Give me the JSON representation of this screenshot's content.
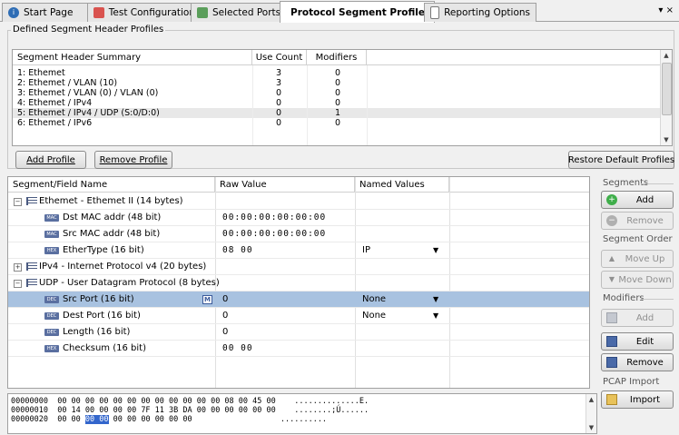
{
  "tabs": [
    {
      "label": "Start Page",
      "icon": "info-icon"
    },
    {
      "label": "Test Configuration",
      "icon": "test-config-icon"
    },
    {
      "label": "Selected Ports",
      "icon": "ports-icon"
    },
    {
      "label": "Protocol Segment Profiles",
      "icon": "profiles-icon",
      "active": true
    },
    {
      "label": "Reporting Options",
      "icon": "report-icon"
    }
  ],
  "tab_overflow_glyph": "▾ ×",
  "profiles": {
    "group_label": "Defined Segment Header Profiles",
    "columns": [
      "Segment Header Summary",
      "Use Count",
      "Modifiers"
    ],
    "rows": [
      {
        "summary": "1: Ethemet",
        "use_count": "3",
        "modifiers": "0"
      },
      {
        "summary": "2: Ethemet / VLAN (10)",
        "use_count": "3",
        "modifiers": "0"
      },
      {
        "summary": "3: Ethemet / VLAN (0) / VLAN (0)",
        "use_count": "0",
        "modifiers": "0"
      },
      {
        "summary": "4: Ethemet / IPv4",
        "use_count": "0",
        "modifiers": "0"
      },
      {
        "summary": "5: Ethemet / IPv4 / UDP (S:0/D:0)",
        "use_count": "0",
        "modifiers": "1"
      },
      {
        "summary": "6: Ethemet / IPv6",
        "use_count": "0",
        "modifiers": "0"
      }
    ],
    "add_button": "Add Profile",
    "remove_button": "Remove Profile",
    "restore_button": "Restore Default Profiles"
  },
  "fields": {
    "columns": [
      "Segment/Field Name",
      "Raw Value",
      "Named Values"
    ],
    "rows": [
      {
        "name": "Ethemet - Ethemet II (14 bytes)",
        "raw": "",
        "named": "",
        "level": 0,
        "expander": "−",
        "kind": "segment"
      },
      {
        "name": "Dst MAC addr (48 bit)",
        "raw": "00:00:00:00:00:00",
        "named": "",
        "level": 1,
        "badge": "MAC",
        "kind": "field"
      },
      {
        "name": "Src MAC addr (48 bit)",
        "raw": "00:00:00:00:00:00",
        "named": "",
        "level": 1,
        "badge": "MAC",
        "kind": "field"
      },
      {
        "name": "EtherType (16 bit)",
        "raw": "08 00",
        "named": "IP",
        "level": 1,
        "badge": "HEX",
        "kind": "field",
        "dropdown": true
      },
      {
        "name": "IPv4 - Internet Protocol v4 (20 bytes)",
        "raw": "",
        "named": "",
        "level": 0,
        "expander": "+",
        "kind": "segment"
      },
      {
        "name": "UDP - User Datagram Protocol (8 bytes)",
        "raw": "",
        "named": "",
        "level": 0,
        "expander": "−",
        "kind": "segment"
      },
      {
        "name": "Src Port (16 bit)",
        "raw": "0",
        "named": "None",
        "level": 1,
        "badge": "DEC",
        "kind": "field",
        "dropdown": true,
        "selected": true,
        "modifier_mark": "M"
      },
      {
        "name": "Dest Port (16 bit)",
        "raw": "0",
        "named": "None",
        "level": 1,
        "badge": "DEC",
        "kind": "field",
        "dropdown": true
      },
      {
        "name": "Length (16 bit)",
        "raw": "0",
        "named": "",
        "level": 1,
        "badge": "DEC",
        "kind": "field"
      },
      {
        "name": "Checksum (16 bit)",
        "raw": "00 00",
        "named": "",
        "level": 1,
        "badge": "HEX",
        "kind": "field"
      }
    ]
  },
  "side": {
    "segments_label": "Segments",
    "add": "Add",
    "remove": "Remove",
    "order_label": "Segment Order",
    "move_up": "Move Up",
    "move_down": "Move Down",
    "modifiers_label": "Modifiers",
    "mod_add": "Add",
    "mod_edit": "Edit",
    "mod_remove": "Remove",
    "pcap_label": "PCAP Import",
    "import": "Import"
  },
  "hexdump": [
    {
      "offset": "00000000",
      "pre": "00 00 00 00 00 00 00 00 00 00 00 00 08 00 45 00",
      "hl": "",
      "post": "",
      "ascii": "..............E."
    },
    {
      "offset": "00000010",
      "pre": "00 14 00 00 00 00 7F 11 3B DA 00 00 00 00 00 00",
      "hl": "",
      "post": "",
      "ascii": "........;Ú......"
    },
    {
      "offset": "00000020",
      "pre": "00 00 ",
      "hl": "00 00",
      "post": " 00 00 00 00 00 00",
      "ascii": ".........."
    }
  ],
  "colors": {
    "selection": "#a8c2e0",
    "hex_highlight": "#3366cc"
  }
}
